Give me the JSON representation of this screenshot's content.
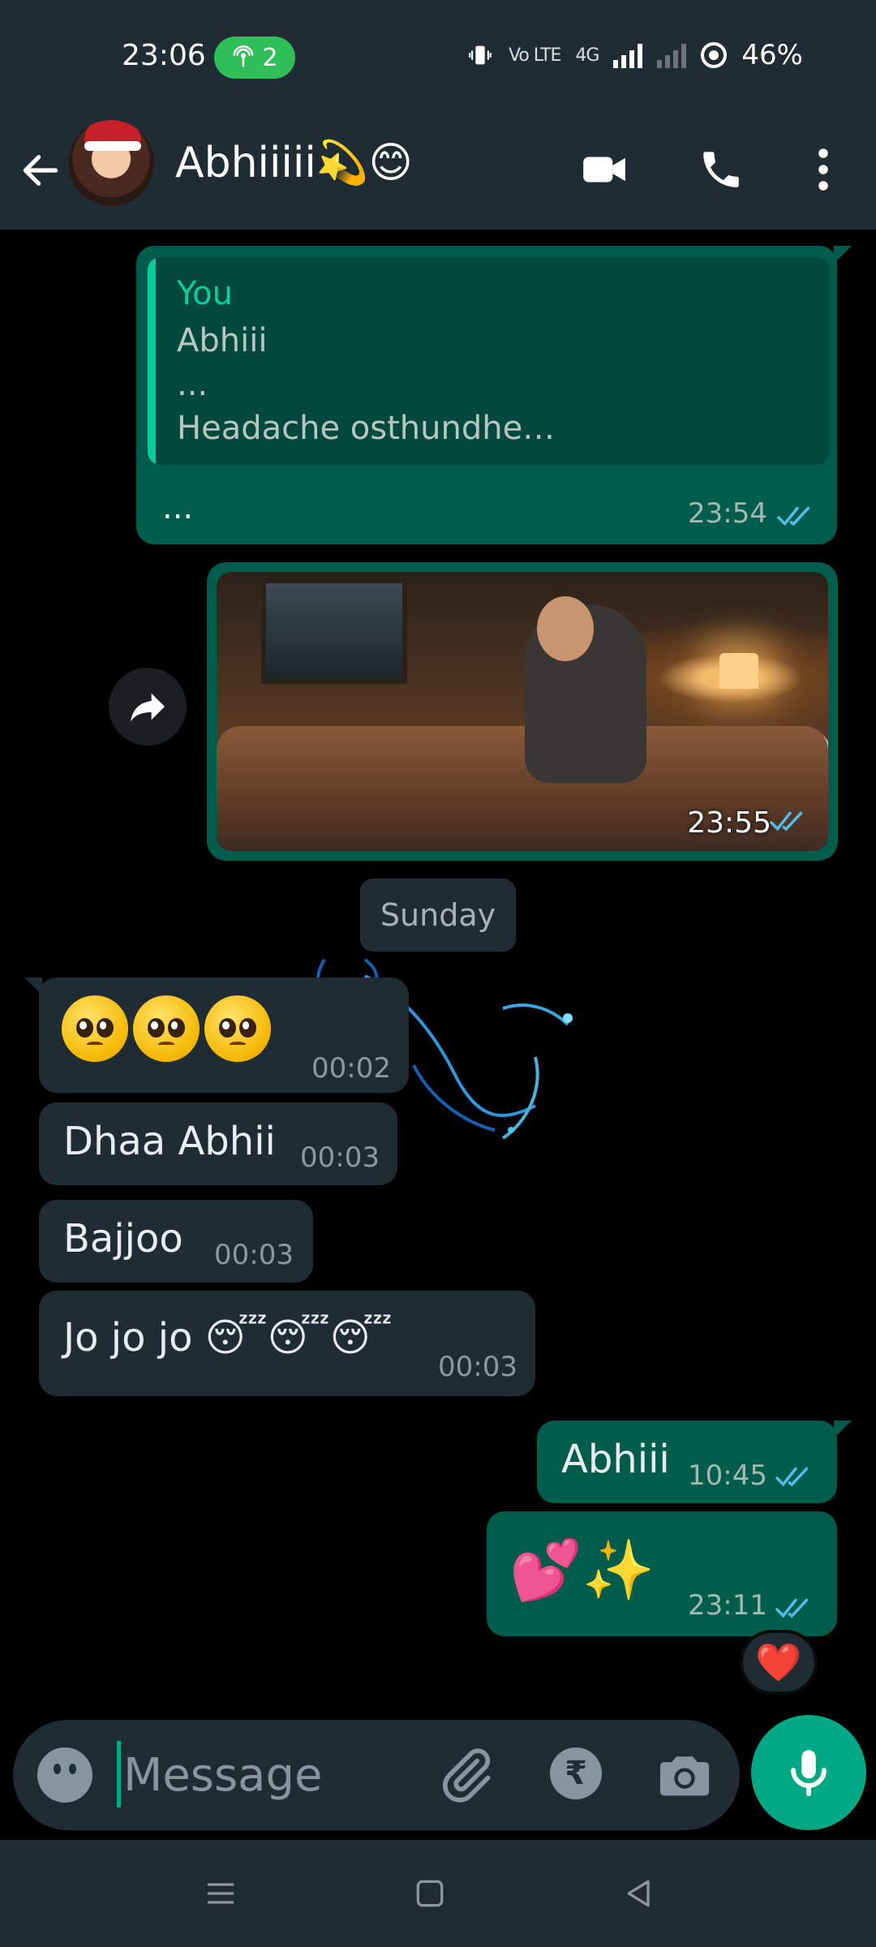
{
  "status_bar": {
    "time": "23:06",
    "hotspot_count": "2",
    "battery": "46%",
    "network_labels": [
      "Vo LTE",
      "4G"
    ]
  },
  "header": {
    "contact_name": "Abhiiiii💫😊"
  },
  "messages": {
    "quoted": {
      "author": "You",
      "lines": [
        "Abhiii",
        "...",
        "Headache osthundhe…"
      ],
      "text": "...",
      "time": "23:54"
    },
    "image_time": "23:55",
    "date_chip": "Sunday",
    "incoming": [
      {
        "text": "🥺🥺🥺",
        "time": "00:02"
      },
      {
        "text": "Dhaa Abhii",
        "time": "00:03"
      },
      {
        "text": "Bajjoo",
        "time": "00:03"
      },
      {
        "text": "Jo jo jo 😴😴😴",
        "time": "00:03"
      }
    ],
    "outgoing": [
      {
        "text": "Abhiii",
        "time": "10:45"
      },
      {
        "text": "💕✨",
        "time": "23:11"
      }
    ],
    "reaction": "❤️"
  },
  "input": {
    "placeholder": "Message"
  },
  "colors": {
    "accent": "#00a884",
    "outgoing_bubble": "#005c4b",
    "incoming_bubble": "#1f2c34",
    "header_bg": "#202c33",
    "read_ticks": "#53bdeb"
  }
}
